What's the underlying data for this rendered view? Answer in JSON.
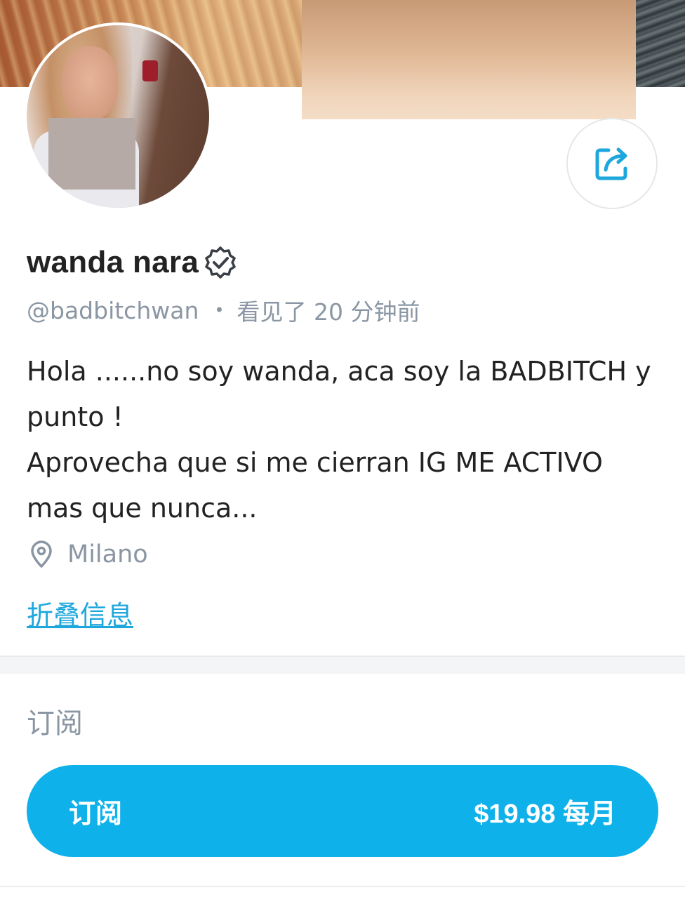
{
  "profile": {
    "name": "wanda nara",
    "handle": "@badbitchwan",
    "separator": "•",
    "last_seen": "看见了  20 分钟前",
    "bio_lines": [
      "Hola ......no soy wanda, aca soy la BADBITCH y",
      "punto !",
      "Aprovecha que si me cierran IG ME ACTIVO",
      "mas que nunca..."
    ],
    "location": "Milano",
    "collapse_label": "折叠信息"
  },
  "icons": {
    "share": "share-icon",
    "verified": "verified-badge-icon",
    "location": "location-pin-icon"
  },
  "subscription": {
    "section_title": "订阅",
    "button_label": "订阅",
    "price": "$19.98 每月"
  },
  "colors": {
    "accent": "#0fb1ea",
    "link": "#1ea7dd",
    "muted_text": "#8a96a3",
    "primary_text": "#222222"
  }
}
